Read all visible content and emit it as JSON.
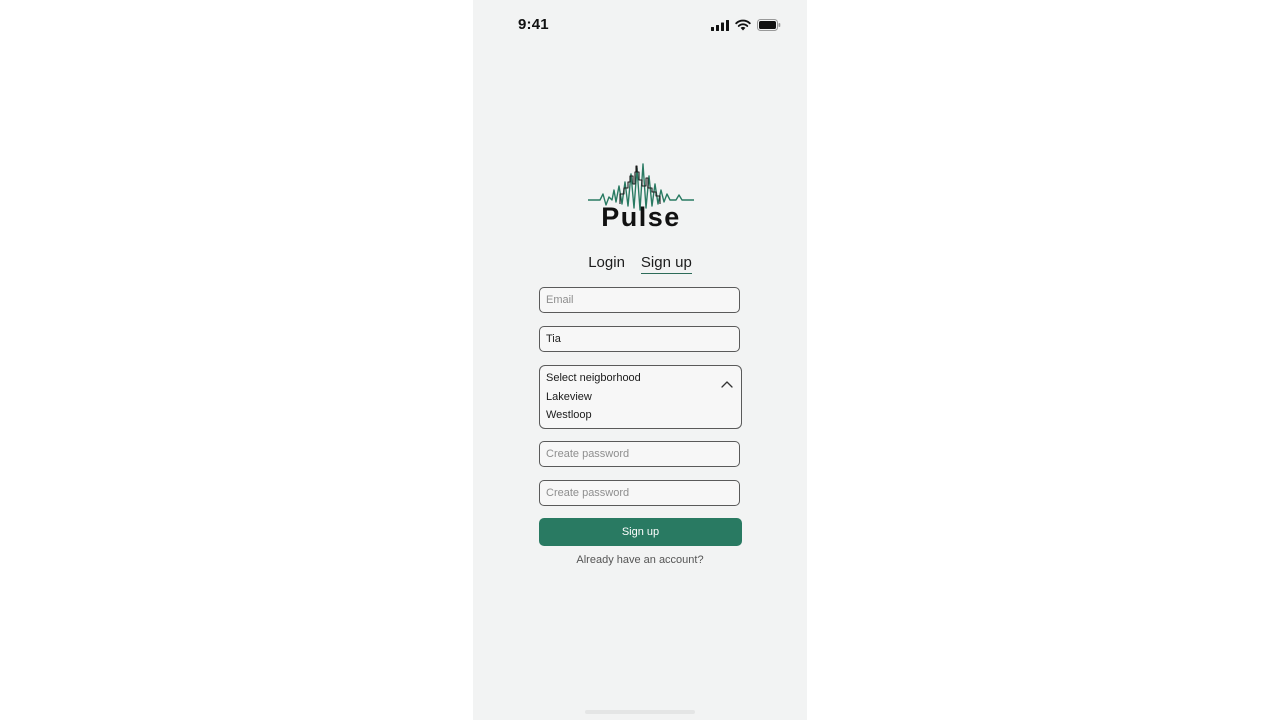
{
  "status_bar": {
    "time": "9:41",
    "icons": [
      "signal-icon",
      "wifi-icon",
      "battery-icon"
    ]
  },
  "logo": {
    "text": "Pulse",
    "accent_color": "#297a62"
  },
  "tabs": [
    {
      "label": "Login",
      "active": false
    },
    {
      "label": "Sign up",
      "active": true
    }
  ],
  "form": {
    "email": {
      "placeholder": "Email",
      "value": ""
    },
    "name": {
      "placeholder": "",
      "value": "Tia"
    },
    "neighborhood": {
      "label": "Select neigborhood",
      "expanded": true,
      "options": [
        "Lakeview",
        "Westloop"
      ]
    },
    "password": {
      "placeholder": "Create password",
      "value": ""
    },
    "confirm_password": {
      "placeholder": "Create password",
      "value": ""
    },
    "submit_label": "Sign up",
    "login_link": "Already have an account?"
  },
  "colors": {
    "accent": "#297a62",
    "background": "#f2f3f3"
  }
}
